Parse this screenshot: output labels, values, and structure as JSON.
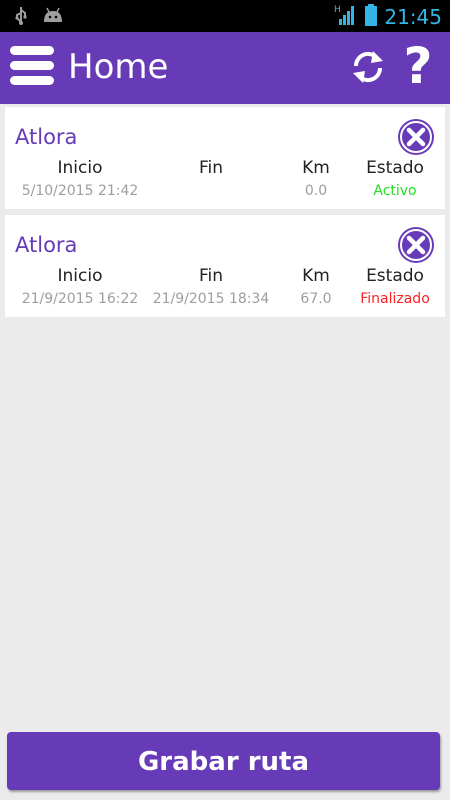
{
  "status_bar": {
    "time": "21:45",
    "network_label": "H"
  },
  "app_bar": {
    "title": "Home"
  },
  "routes": [
    {
      "name": "Atlora",
      "headers": {
        "start": "Inicio",
        "end": "Fin",
        "km": "Km",
        "state": "Estado"
      },
      "start": "5/10/2015 21:42",
      "end": "",
      "km": "0.0",
      "state": "Activo",
      "state_color": "#22dd22"
    },
    {
      "name": "Atlora",
      "headers": {
        "start": "Inicio",
        "end": "Fin",
        "km": "Km",
        "state": "Estado"
      },
      "start": "21/9/2015 16:22",
      "end": "21/9/2015 18:34",
      "km": "67.0",
      "state": "Finalizado",
      "state_color": "#ff2222"
    }
  ],
  "bottom_button": {
    "label": "Grabar ruta"
  },
  "colors": {
    "primary": "#673ab7",
    "background": "#ebebeb",
    "status_bar": "#000000",
    "clock": "#33b5e5"
  }
}
